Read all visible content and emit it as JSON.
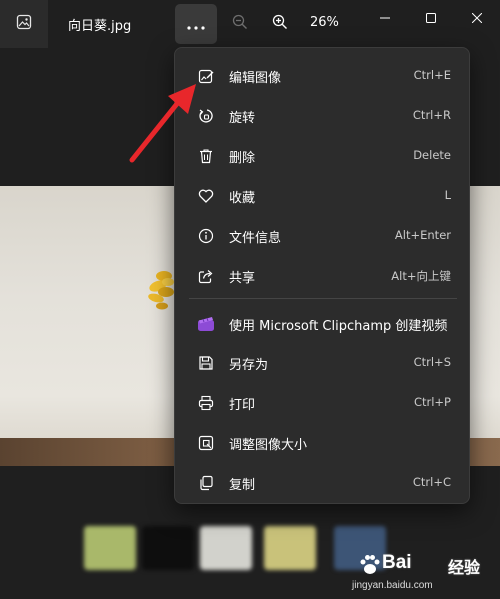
{
  "titlebar": {
    "file_name": "向日葵.jpg",
    "zoom_level": "26%",
    "icons": {
      "app": "image-gallery-icon",
      "more": "more-horizontal-icon",
      "zoom_out": "zoom-out-icon",
      "zoom_in": "zoom-in-icon",
      "minimize": "minimize-icon",
      "maximize": "maximize-icon",
      "close": "close-icon"
    }
  },
  "menu": {
    "items": [
      {
        "label": "编辑图像",
        "shortcut": "Ctrl+E",
        "icon": "edit-image-icon"
      },
      {
        "label": "旋转",
        "shortcut": "Ctrl+R",
        "icon": "rotate-icon"
      },
      {
        "label": "删除",
        "shortcut": "Delete",
        "icon": "delete-icon"
      },
      {
        "label": "收藏",
        "shortcut": "L",
        "icon": "heart-icon"
      },
      {
        "label": "文件信息",
        "shortcut": "Alt+Enter",
        "icon": "info-icon"
      },
      {
        "label": "共享",
        "shortcut": "Alt+向上键",
        "icon": "share-icon"
      },
      {
        "label": "使用 Microsoft Clipchamp 创建视频",
        "shortcut": "",
        "icon": "clipchamp-icon"
      },
      {
        "label": "另存为",
        "shortcut": "Ctrl+S",
        "icon": "save-icon"
      },
      {
        "label": "打印",
        "shortcut": "Ctrl+P",
        "icon": "print-icon"
      },
      {
        "label": "调整图像大小",
        "shortcut": "",
        "icon": "resize-image-icon"
      },
      {
        "label": "复制",
        "shortcut": "Ctrl+C",
        "icon": "copy-icon"
      }
    ]
  },
  "annotation": {
    "icon": "red-arrow-icon",
    "color": "#e8272b"
  },
  "watermark": {
    "brand": "Bai",
    "brand_suffix": "经验",
    "url": "jingyan.baidu.com"
  },
  "colors": {
    "background": "#1f1f1f",
    "menu_bg": "#2c2c2c",
    "text": "#ffffff",
    "shortcut_text": "#c9c9c9"
  }
}
